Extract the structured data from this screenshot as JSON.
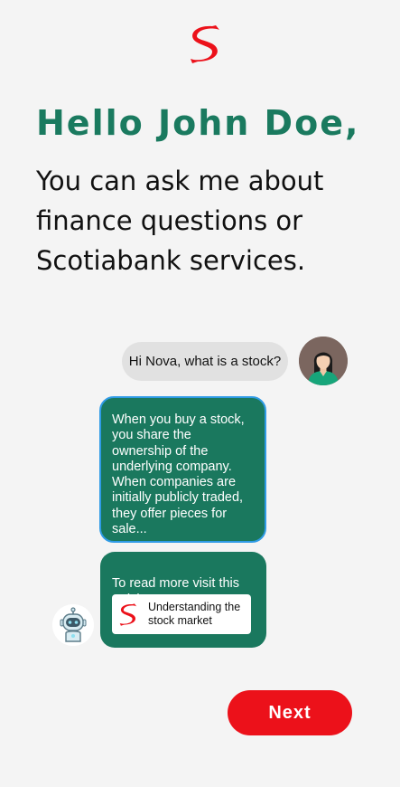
{
  "brand": {
    "logo_icon": "scotiabank-logo-icon",
    "accent_color": "#ec111a",
    "primary_green": "#1a785e"
  },
  "header": {
    "greeting": "Hello John Doe,",
    "intro": "You can ask me about finance questions or Scotiabank services."
  },
  "chat": {
    "user_message": "Hi Nova, what is a stock?",
    "user_avatar_icon": "user-avatar-icon",
    "bot_message": "When you buy a stock,\nyou share the\nownership of the\nunderlying company.\nWhen companies are\ninitially publicly traded,\nthey offer pieces for\nsale...",
    "bot_article_intro": "To read more visit this\narticle:",
    "article_title": "Understanding the\nstock market",
    "bot_avatar_icon": "robot-avatar-icon"
  },
  "actions": {
    "next_label": "Next"
  }
}
